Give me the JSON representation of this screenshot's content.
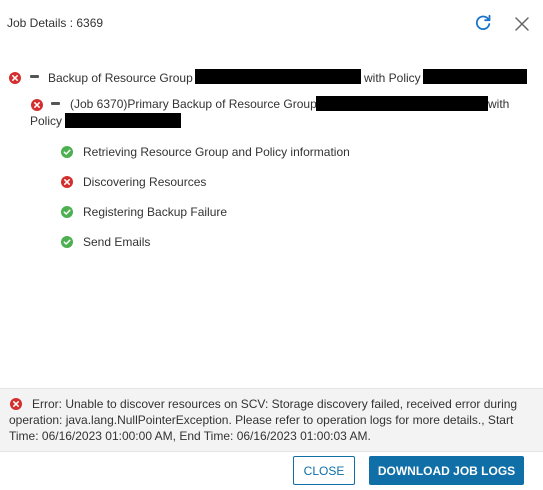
{
  "header": {
    "title": "Job Details : 6369"
  },
  "tree": {
    "parent": {
      "status": "error",
      "text_prefix": "Backup of Resource Group",
      "text_middle": "with Policy"
    },
    "child": {
      "status": "error",
      "text_prefix": "(Job 6370)Primary Backup of Resource Group",
      "text_middle": "with",
      "text_line2": "Policy"
    },
    "steps": [
      {
        "status": "success",
        "label": "Retrieving Resource Group and Policy information"
      },
      {
        "status": "error",
        "label": "Discovering Resources"
      },
      {
        "status": "success",
        "label": "Registering Backup Failure"
      },
      {
        "status": "success",
        "label": "Send Emails"
      }
    ]
  },
  "error": {
    "message": "Error: Unable to discover resources on SCV: Storage discovery failed, received error during operation: java.lang.NullPointerException. Please refer to operation logs for more details., Start Time: 06/16/2023 01:00:00 AM, End Time: 06/16/2023 01:00:03 AM."
  },
  "footer": {
    "close_label": "CLOSE",
    "download_label": "DOWNLOAD JOB LOGS"
  },
  "colors": {
    "accent": "#0f6fa6",
    "success": "#4caf50",
    "error": "#d32f2f"
  }
}
